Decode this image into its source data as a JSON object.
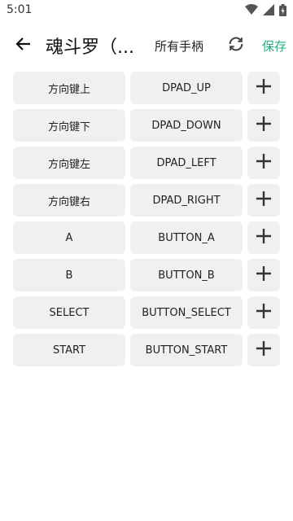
{
  "status_bar": {
    "time": "5:01",
    "icons": [
      "wifi-icon",
      "signal-icon",
      "battery-icon"
    ]
  },
  "app_bar": {
    "back_icon": "arrow-left-icon",
    "title": "魂斗罗（...",
    "controller_filter": "所有手柄",
    "refresh_icon": "refresh-icon",
    "save_label": "保存",
    "save_color": "#1db47a"
  },
  "mappings": [
    {
      "key": "方向键上",
      "mapped": "DPAD_UP"
    },
    {
      "key": "方向键下",
      "mapped": "DPAD_DOWN"
    },
    {
      "key": "方向键左",
      "mapped": "DPAD_LEFT"
    },
    {
      "key": "方向键右",
      "mapped": "DPAD_RIGHT"
    },
    {
      "key": "A",
      "mapped": "BUTTON_A"
    },
    {
      "key": "B",
      "mapped": "BUTTON_B"
    },
    {
      "key": "SELECT",
      "mapped": "BUTTON_SELECT"
    },
    {
      "key": "START",
      "mapped": "BUTTON_START"
    }
  ],
  "add_icon": "plus-icon"
}
